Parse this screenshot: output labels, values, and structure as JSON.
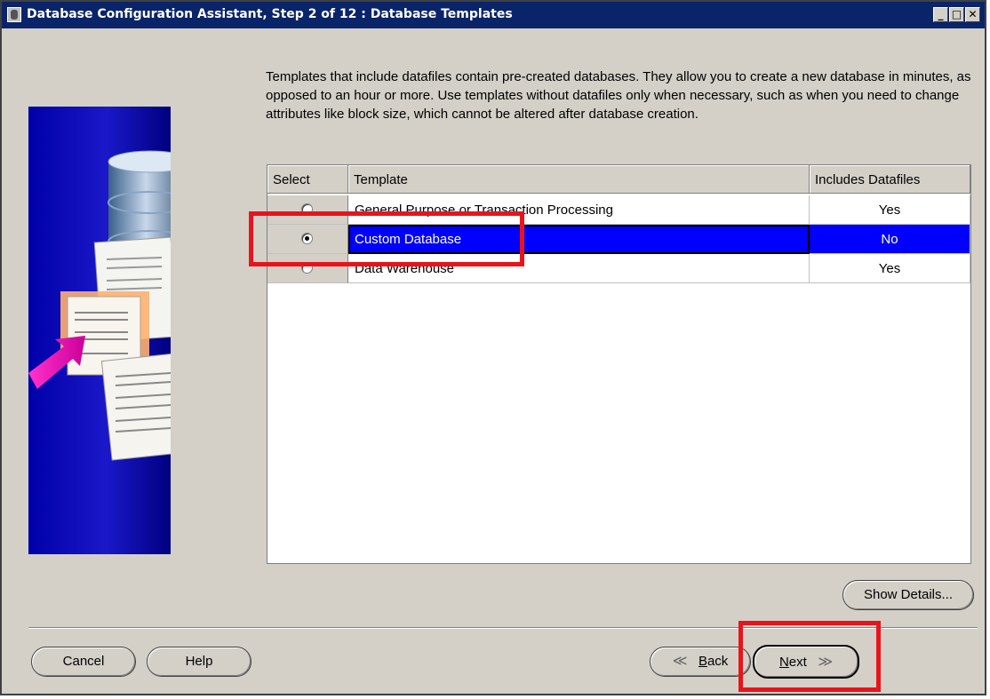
{
  "window": {
    "title": "Database Configuration Assistant, Step 2 of 12 : Database Templates",
    "controls": {
      "minimize": "_",
      "maximize": "□",
      "close": "✕"
    }
  },
  "description": "Templates that include datafiles contain pre-created databases. They allow you to create a new database in minutes, as opposed to an hour or more. Use templates without datafiles only when necessary, such as when you need to change attributes like block size, which cannot be altered after database creation.",
  "table": {
    "headers": {
      "select": "Select",
      "template": "Template",
      "datafiles": "Includes Datafiles"
    },
    "rows": [
      {
        "template": "General Purpose or Transaction Processing",
        "datafiles": "Yes",
        "selected": false
      },
      {
        "template": "Custom Database",
        "datafiles": "No",
        "selected": true
      },
      {
        "template": "Data Warehouse",
        "datafiles": "Yes",
        "selected": false
      }
    ]
  },
  "buttons": {
    "show_details": "Show Details...",
    "cancel": "Cancel",
    "help": "Help",
    "back_arrow": "≪",
    "back_mnemonic": "B",
    "back_rest": "ack",
    "next_mnemonic": "N",
    "next_rest": "ext",
    "next_arrow": "≫"
  },
  "colors": {
    "title_bar": "#0a246a",
    "selection": "#0000ff",
    "highlight_annotation": "#e8141c"
  }
}
